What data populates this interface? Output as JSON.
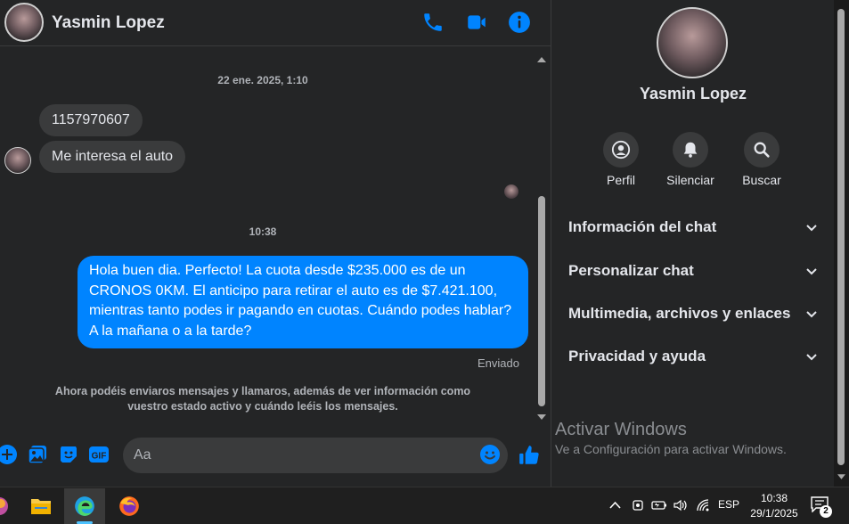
{
  "contact": {
    "name": "Yasmin Lopez"
  },
  "header": {
    "icons": [
      "phone-icon",
      "video-icon",
      "info-icon"
    ]
  },
  "messages": {
    "ts1": "22 ene. 2025, 1:10",
    "in1": "1157970607",
    "in2": "Me interesa el auto",
    "ts2": "10:38",
    "out1": "Hola buen dia. Perfecto! La cuota desde $235.000 es de un CRONOS 0KM. El anticipo para retirar el auto es de $7.421.100, mientras tanto podes ir pagando en cuotas. Cuándo podes hablar? A la mañana o a la tarde?",
    "status": "Enviado",
    "notice": "Ahora podéis enviaros mensajes y llamaros, además de ver información como vuestro estado activo y cuándo leéis los mensajes."
  },
  "composer": {
    "placeholder": "Aa",
    "icons": [
      "plus-icon",
      "image-icon",
      "sticker-icon",
      "gif-icon",
      "emoji-icon",
      "like-icon"
    ]
  },
  "sidebar": {
    "name": "Yasmin Lopez",
    "actions": {
      "profile": "Perfil",
      "mute": "Silenciar",
      "search": "Buscar"
    },
    "sections": [
      "Información del chat",
      "Personalizar chat",
      "Multimedia, archivos y enlaces",
      "Privacidad y ayuda"
    ]
  },
  "watermark": {
    "title": "Activar Windows",
    "subtitle": "Ve a Configuración para activar Windows."
  },
  "taskbar": {
    "apps": [
      "app-icon",
      "file-explorer-icon",
      "edge-icon",
      "firefox-icon"
    ],
    "lang": "ESP",
    "time": "10:38",
    "date": "29/1/2025",
    "notif_count": "2"
  },
  "colors": {
    "accent": "#0084ff",
    "bg": "#242526",
    "bubble_in": "#3a3b3c"
  }
}
